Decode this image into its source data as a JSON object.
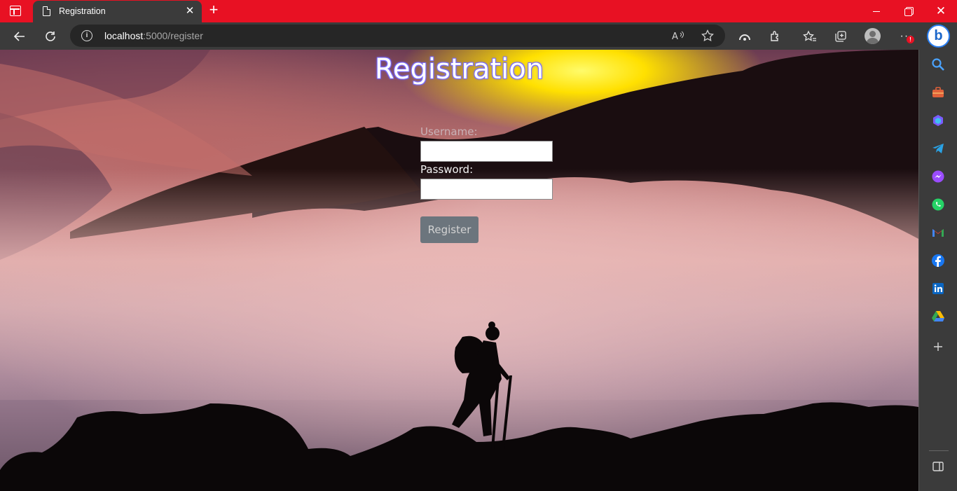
{
  "browser": {
    "tab_title": "Registration",
    "url_host": "localhost",
    "url_path": ":5000/register",
    "tab_close": "✕",
    "new_tab": "+",
    "window_close": "✕",
    "more_badge": "!"
  },
  "page": {
    "title": "Registration",
    "username_label": "Username:",
    "username_value": "",
    "password_label": "Password:",
    "password_value": "",
    "register_button": "Register"
  },
  "colors": {
    "titlebar": "#e81123",
    "toolbar": "#3b3b3b",
    "button": "#6c757d",
    "title_outline": "#7a6cff"
  },
  "sidebar_icons": [
    "search-icon",
    "tools-icon",
    "copilot-icon",
    "telegram-icon",
    "messenger-icon",
    "whatsapp-icon",
    "gmail-icon",
    "facebook-icon",
    "linkedin-icon",
    "google-drive-icon",
    "add-icon",
    "sidebar-toggle-icon"
  ]
}
